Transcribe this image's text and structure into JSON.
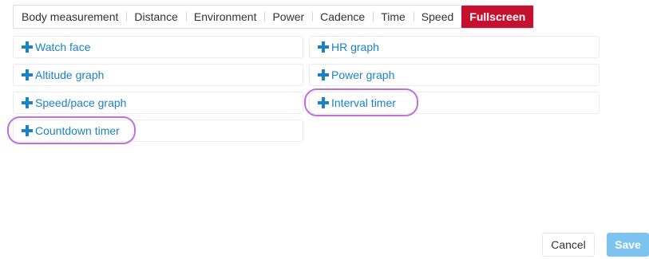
{
  "tabs": [
    {
      "label": "Body measurement",
      "active": false
    },
    {
      "label": "Distance",
      "active": false
    },
    {
      "label": "Environment",
      "active": false
    },
    {
      "label": "Power",
      "active": false
    },
    {
      "label": "Cadence",
      "active": false
    },
    {
      "label": "Time",
      "active": false
    },
    {
      "label": "Speed",
      "active": false
    },
    {
      "label": "Fullscreen",
      "active": true
    }
  ],
  "items": [
    {
      "label": "Watch face",
      "highlighted": false
    },
    {
      "label": "HR graph",
      "highlighted": false
    },
    {
      "label": "Altitude graph",
      "highlighted": false
    },
    {
      "label": "Power graph",
      "highlighted": false
    },
    {
      "label": "Speed/pace graph",
      "highlighted": false
    },
    {
      "label": "Interval timer",
      "highlighted": true
    },
    {
      "label": "Countdown timer",
      "highlighted": true
    }
  ],
  "icons": {
    "add": "plus-icon"
  },
  "colors": {
    "accent": "#c5102f",
    "link": "#1b82c5",
    "highlight": "#c46ddc",
    "save": "#7cc4ee"
  },
  "buttons": {
    "cancel_label": "Cancel",
    "save_label": "Save"
  }
}
